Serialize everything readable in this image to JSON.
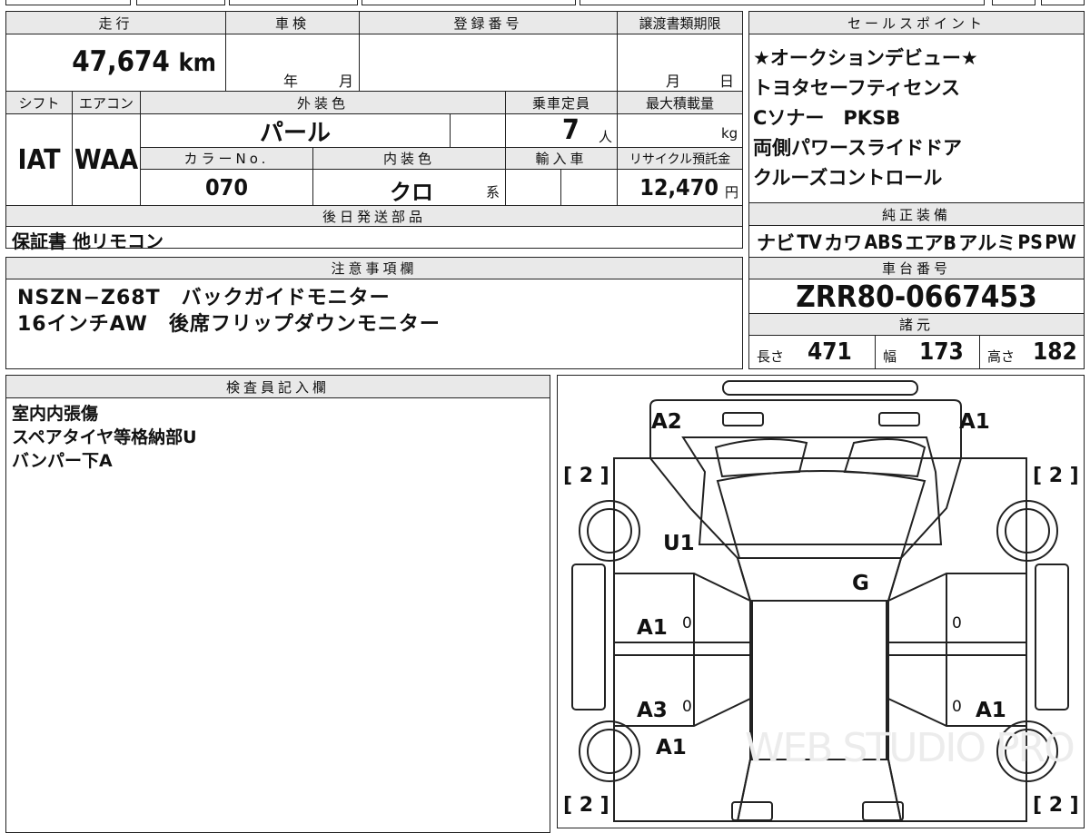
{
  "header_labels": {
    "mileage": "走行",
    "inspection": "車検",
    "registration": "登録番号",
    "transfer_deadline": "譲渡書類期限",
    "shift": "シフト",
    "aircon": "エアコン",
    "exterior_color": "外装色",
    "capacity": "乗車定員",
    "max_load": "最大積載量",
    "color_no": "カラーNo.",
    "interior_color": "内装色",
    "import": "輸入車",
    "recycle_fee": "リサイクル預託金",
    "later_parts": "後日発送部品",
    "notes": "注意事項欄",
    "inspector": "検査員記入欄",
    "sales_points": "セールスポイント",
    "genuine_equipment": "純正装備",
    "chassis_no": "車台番号",
    "specs": "諸元"
  },
  "vehicle": {
    "mileage": "47,674",
    "mileage_unit": "km",
    "year_unit": "年",
    "month_unit": "月",
    "deadline_month": "月",
    "deadline_day": "日",
    "shift": "IAT",
    "aircon": "WAA",
    "exterior_color": "パール",
    "capacity": "7",
    "capacity_unit": "人",
    "load_unit": "kg",
    "color_no": "070",
    "interior_color": "クロ",
    "interior_suffix": "系",
    "recycle_fee": "12,470",
    "recycle_unit": "円"
  },
  "later_parts": "保証書 他リモコン",
  "notes": [
    "NSZN−Z68T　バックガイドモニター",
    "16インチAW　後席フリップダウンモニター"
  ],
  "inspector_notes": [
    "室内内張傷",
    "スペアタイヤ等格納部U",
    "バンパー下A"
  ],
  "sales_points": [
    "★オークションデビュー★",
    "トヨタセーフティセンス",
    "Cソナー　PKSB",
    "両側パワースライドドア",
    "クルーズコントロール"
  ],
  "equipment": [
    "ナビ",
    "TV",
    "カワ",
    "ABS",
    "エアB",
    "アルミ",
    "PS",
    "PW"
  ],
  "chassis_no": "ZRR80-0667453",
  "specs": {
    "length_label": "長さ",
    "length": "471",
    "width_label": "幅",
    "width": "173",
    "height_label": "高さ",
    "height": "182"
  },
  "diagram": {
    "marks": {
      "a2_front_left": "A2",
      "a1_front_right": "A1",
      "u1": "U1",
      "g": "G",
      "a1_left_front_door": "A1",
      "a3_left_rear_door": "A3",
      "a1_right_rear_door": "A1",
      "a1_left_rear": "A1"
    },
    "tire_labels": [
      "[ 2 ]",
      "[ 2 ]",
      "[ 2 ]",
      "[ 2 ]"
    ],
    "door_zero": "0",
    "watermark": "WEB STUDIO PRO"
  }
}
